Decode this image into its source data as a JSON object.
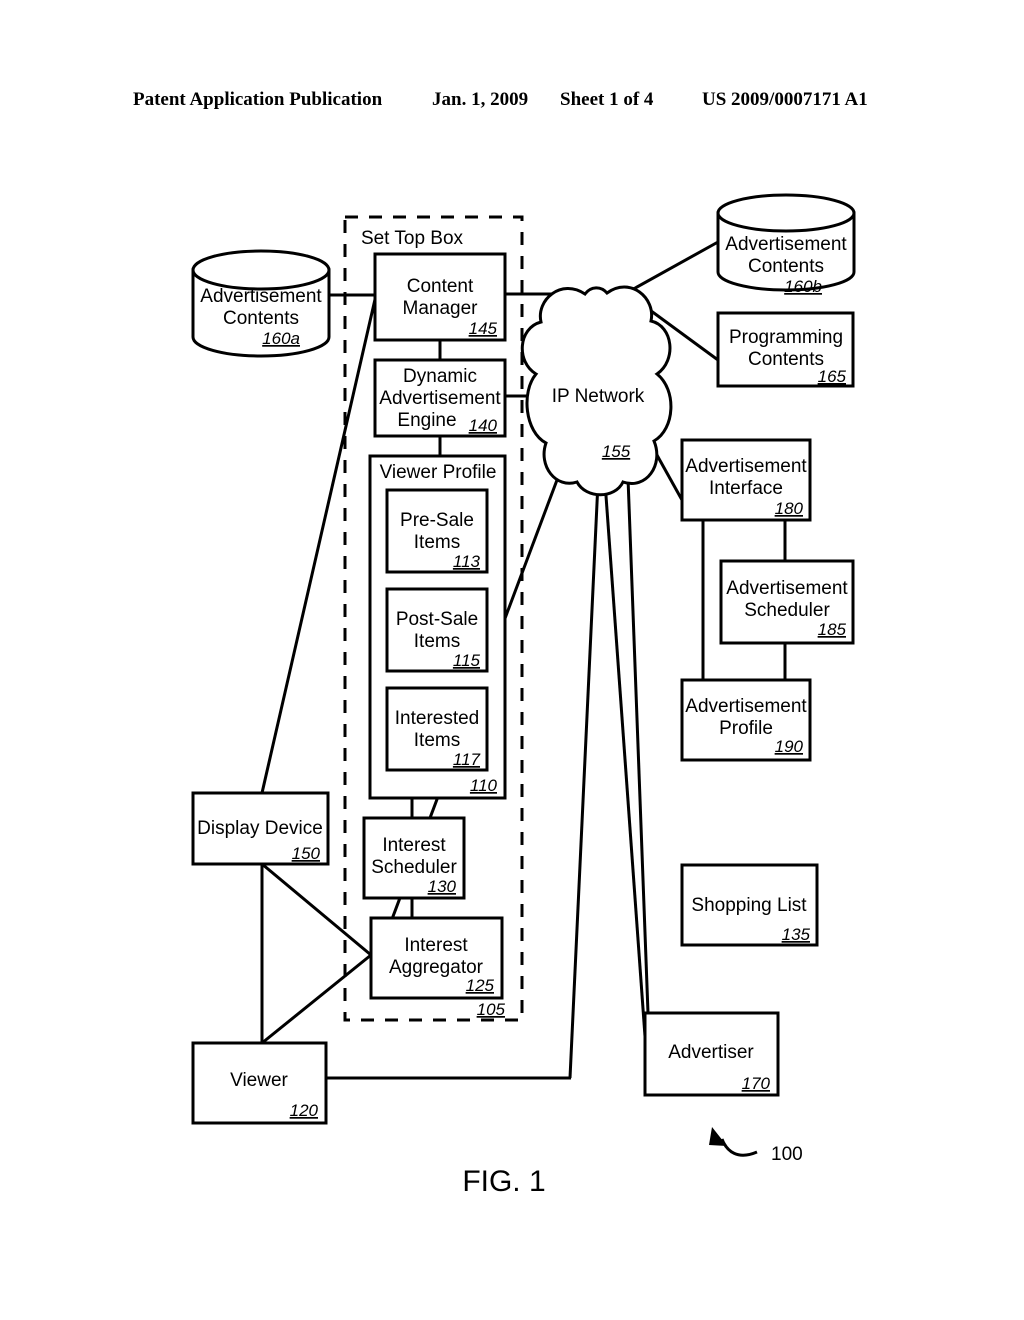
{
  "header": {
    "publication": "Patent Application Publication",
    "date": "Jan. 1, 2009",
    "sheet": "Sheet 1 of 4",
    "number": "US 2009/0007171 A1"
  },
  "figure": {
    "caption": "FIG. 1",
    "system_ref": "100"
  },
  "diagram": {
    "set_top_box": {
      "title": "Set Top Box",
      "ref": "105"
    },
    "ad_contents_local": {
      "line1": "Advertisement",
      "line2": "Contents",
      "ref": "160a"
    },
    "content_manager": {
      "line1": "Content",
      "line2": "Manager",
      "ref": "145"
    },
    "dynamic_ad_engine": {
      "line1": "Dynamic",
      "line2": "Advertisement",
      "line3": "Engine",
      "ref": "140"
    },
    "viewer_profile": {
      "title": "Viewer Profile",
      "ref": "110",
      "items": [
        {
          "line1": "Pre-Sale",
          "line2": "Items",
          "ref": "113"
        },
        {
          "line1": "Post-Sale",
          "line2": "Items",
          "ref": "115"
        },
        {
          "line1": "Interested",
          "line2": "Items",
          "ref": "117"
        }
      ]
    },
    "interest_scheduler": {
      "line1": "Interest",
      "line2": "Scheduler",
      "ref": "130"
    },
    "interest_aggregator": {
      "line1": "Interest",
      "line2": "Aggregator",
      "ref": "125"
    },
    "display_device": {
      "line1": "Display Device",
      "ref": "150"
    },
    "viewer": {
      "line1": "Viewer",
      "ref": "120"
    },
    "ip_network": {
      "line1": "IP Network",
      "ref": "155"
    },
    "ad_contents_remote": {
      "line1": "Advertisement",
      "line2": "Contents",
      "ref": "160b"
    },
    "programming_contents": {
      "line1": "Programming",
      "line2": "Contents",
      "ref": "165"
    },
    "ad_interface": {
      "line1": "Advertisement",
      "line2": "Interface",
      "ref": "180"
    },
    "ad_scheduler": {
      "line1": "Advertisement",
      "line2": "Scheduler",
      "ref": "185"
    },
    "ad_profile": {
      "line1": "Advertisement",
      "line2": "Profile",
      "ref": "190"
    },
    "shopping_list": {
      "line1": "Shopping List",
      "ref": "135"
    },
    "advertiser": {
      "line1": "Advertiser",
      "ref": "170"
    }
  },
  "colors": {
    "ink": "#000000",
    "paper": "#ffffff"
  }
}
